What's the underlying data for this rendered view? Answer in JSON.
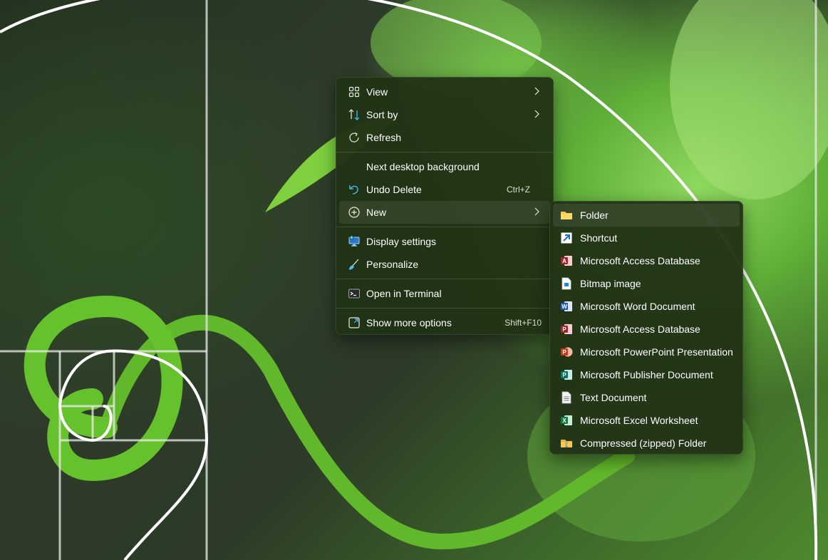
{
  "context_menu": {
    "items": [
      {
        "label": "View",
        "icon": "grid-icon",
        "has_submenu": true
      },
      {
        "label": "Sort by",
        "icon": "sort-arrows-icon",
        "has_submenu": true
      },
      {
        "label": "Refresh",
        "icon": "refresh-icon"
      },
      {
        "label": "Next desktop background"
      },
      {
        "label": "Undo Delete",
        "icon": "undo-icon",
        "shortcut": "Ctrl+Z"
      },
      {
        "label": "New",
        "icon": "plus-circle-icon",
        "has_submenu": true,
        "highlighted": true
      },
      {
        "label": "Display settings",
        "icon": "display-icon"
      },
      {
        "label": "Personalize",
        "icon": "brush-icon"
      },
      {
        "label": "Open in Terminal",
        "icon": "terminal-icon"
      },
      {
        "label": "Show more options",
        "icon": "expand-icon",
        "shortcut": "Shift+F10"
      }
    ]
  },
  "new_submenu": {
    "items": [
      {
        "label": "Folder",
        "icon": "folder-icon",
        "highlighted": true
      },
      {
        "label": "Shortcut",
        "icon": "shortcut-icon"
      },
      {
        "label": "Microsoft Access Database",
        "icon": "access-icon"
      },
      {
        "label": "Bitmap image",
        "icon": "bitmap-icon"
      },
      {
        "label": "Microsoft Word Document",
        "icon": "word-icon"
      },
      {
        "label": "Microsoft Access Database",
        "icon": "access-icon"
      },
      {
        "label": "Microsoft PowerPoint Presentation",
        "icon": "powerpoint-icon"
      },
      {
        "label": "Microsoft Publisher Document",
        "icon": "publisher-icon"
      },
      {
        "label": "Text Document",
        "icon": "text-document-icon"
      },
      {
        "label": "Microsoft Excel Worksheet",
        "icon": "excel-icon"
      },
      {
        "label": "Compressed (zipped) Folder",
        "icon": "zip-folder-icon"
      }
    ]
  },
  "colors": {
    "menu_background": "#213316",
    "access_red": "#a4262c",
    "word_blue": "#185abd",
    "powerpoint_orange": "#c43e1c",
    "publisher_teal": "#077568",
    "excel_green": "#107c41",
    "folder_yellow": "#f8c94b",
    "accent_blue": "#4cc2ff"
  }
}
